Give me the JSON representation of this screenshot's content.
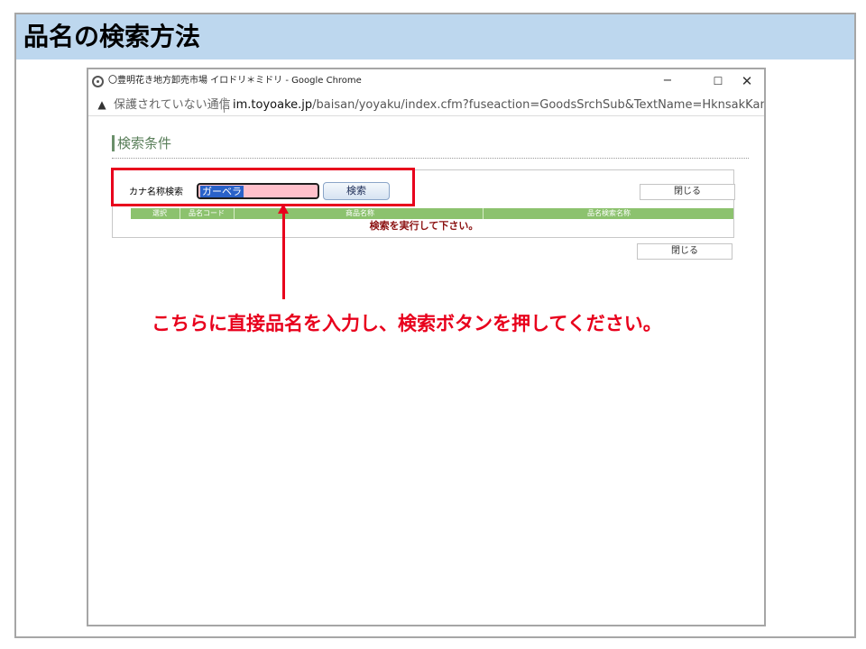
{
  "slide": {
    "title": "品名の検索方法",
    "instruction": "こちらに直接品名を入力し、検索ボタンを押してください。"
  },
  "browser": {
    "window_title": "〇豊明花き地方卸売市場 イロドリ＊ミドリ - Google Chrome",
    "minimize_label": "−",
    "maximize_label": "☐",
    "close_label": "✕",
    "security_label": "保護されていない通信",
    "url_host": "im.toyoake.jp",
    "url_path": "/baisan/yoyaku/index.cfm?fuseaction=GoodsSrchSub&TextName=HknsakKana&Tex..."
  },
  "page": {
    "section_title": "検索条件",
    "field_label": "カナ名称検索",
    "kana_value": "ガーベラ",
    "search_button": "検索",
    "close_button": "閉じる",
    "columns": [
      "選択",
      "品名コード",
      "商品名称",
      "品名検索名称"
    ],
    "empty_message": "検索を実行して下さい。"
  },
  "colors": {
    "annotation": "#e8001c",
    "header_band": "#bdd7ee",
    "table_header": "#8cc26e"
  }
}
